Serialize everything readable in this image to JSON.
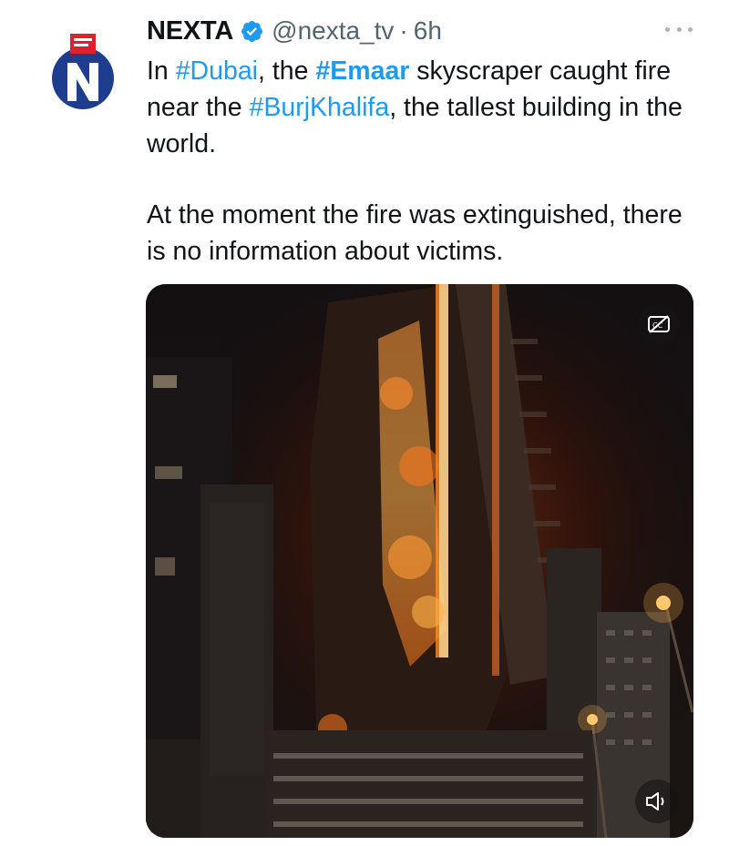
{
  "tweet": {
    "author": {
      "display_name": "NEXTA",
      "handle": "@nexta_tv",
      "verified_icon": "verified-badge-icon",
      "avatar": "nexta-logo"
    },
    "separator": "·",
    "time": "6h",
    "more_icon": "more-options-icon",
    "text": {
      "p1": {
        "t1": "In ",
        "tag_dubai": "#Dubai",
        "t2": ", the ",
        "tag_emaar": "#Emaar",
        "t3": " skyscraper caught fire near the ",
        "tag_burj": "#BurjKhalifa",
        "t4": ", the tallest building in the world."
      },
      "p2": "At the moment the fire was extinguished, there is no information about victims."
    },
    "media": {
      "type": "video",
      "captions_icon": "captions-off-icon",
      "volume_icon": "volume-icon"
    }
  },
  "colors": {
    "link": "#1d9bf0",
    "text": "#0f1419",
    "secondary_text": "#536471",
    "verified": "#1d9bf0",
    "brand_red": "#e0202d",
    "brand_blue": "#1d3a8a"
  }
}
